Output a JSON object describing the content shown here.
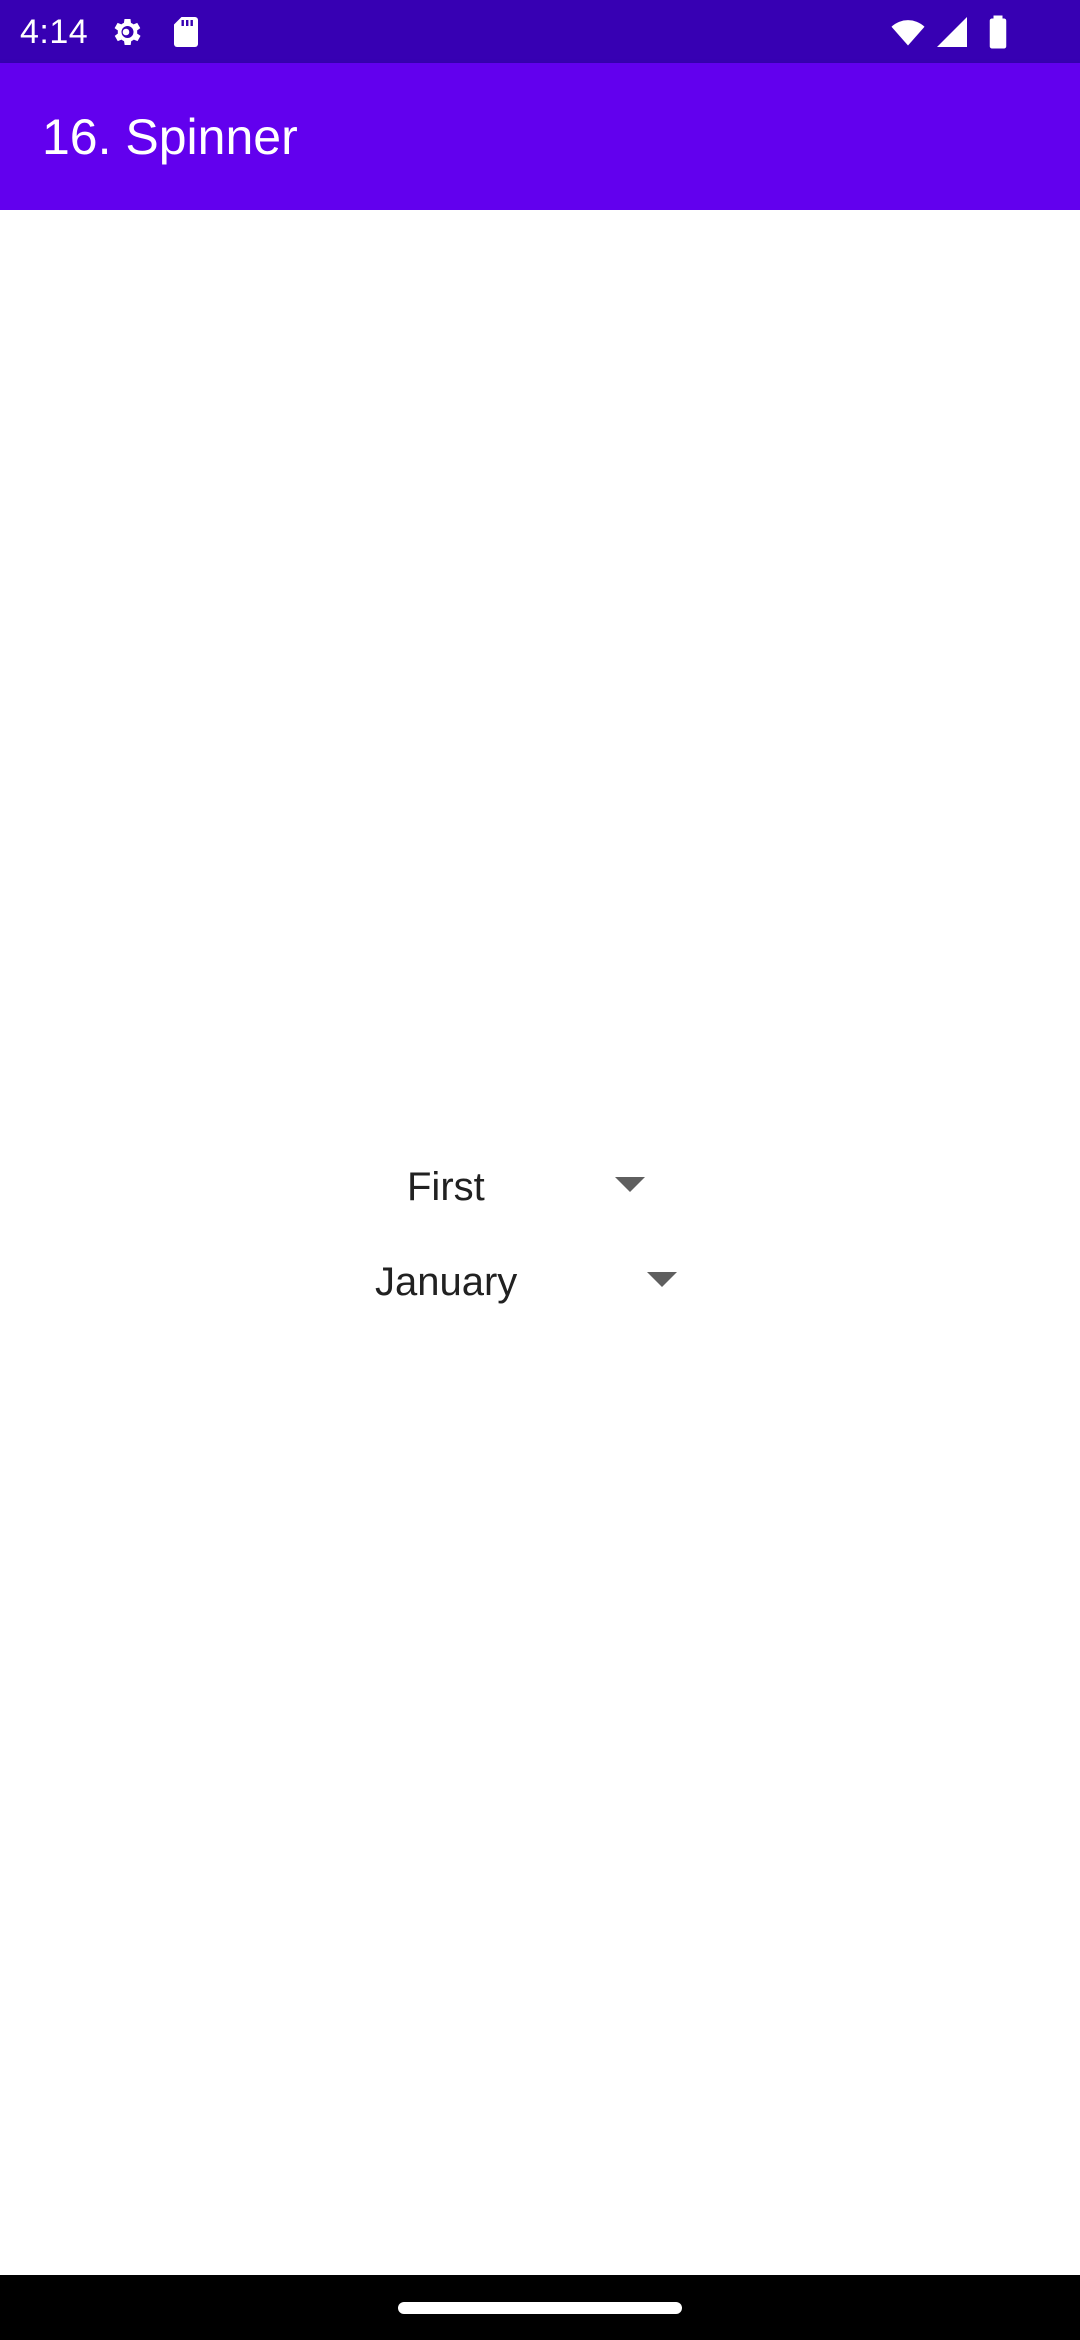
{
  "status_bar": {
    "time": "4:14",
    "icons": [
      "settings-gear-icon",
      "sd-card-icon",
      "wifi-icon",
      "cellular-signal-icon",
      "battery-icon"
    ]
  },
  "app_bar": {
    "title": "16. Spinner"
  },
  "spinners": [
    {
      "selected": "First"
    },
    {
      "selected": "January"
    }
  ],
  "colors": {
    "status_bar": "#3700b3",
    "app_bar": "#6200ee",
    "background": "#ffffff",
    "nav_bar": "#000000",
    "text": "#212121"
  }
}
